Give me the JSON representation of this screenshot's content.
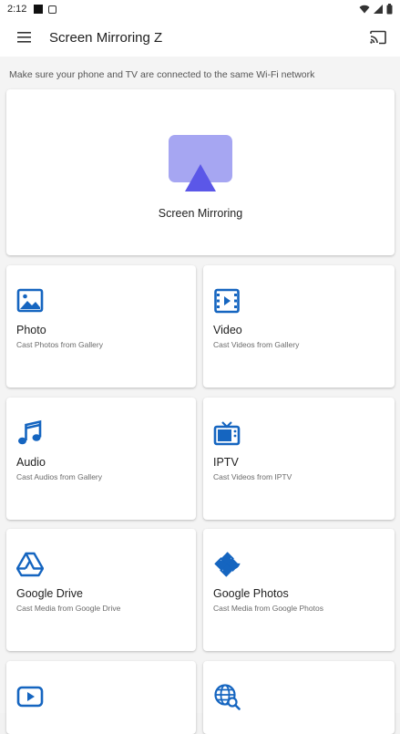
{
  "status": {
    "time": "2:12"
  },
  "app": {
    "title": "Screen Mirroring Z"
  },
  "hint": "Make sure your phone and TV are connected to the same Wi-Fi network",
  "hero": {
    "label": "Screen Mirroring"
  },
  "tiles": [
    {
      "title": "Photo",
      "subtitle": "Cast Photos from Gallery",
      "icon": "photo-icon"
    },
    {
      "title": "Video",
      "subtitle": "Cast Videos from Gallery",
      "icon": "video-icon"
    },
    {
      "title": "Audio",
      "subtitle": "Cast Audios from Gallery",
      "icon": "music-icon"
    },
    {
      "title": "IPTV",
      "subtitle": "Cast Videos from IPTV",
      "icon": "tv-icon"
    },
    {
      "title": "Google Drive",
      "subtitle": "Cast Media from Google Drive",
      "icon": "google-drive-icon"
    },
    {
      "title": "Google Photos",
      "subtitle": "Cast Media from Google Photos",
      "icon": "pinwheel-icon"
    },
    {
      "icon": "youtube-play-icon"
    },
    {
      "icon": "web-search-icon"
    }
  ],
  "colors": {
    "accent": "#1565c0",
    "hero_light": "#a6a6f2",
    "hero_dark": "#5b57e8"
  }
}
